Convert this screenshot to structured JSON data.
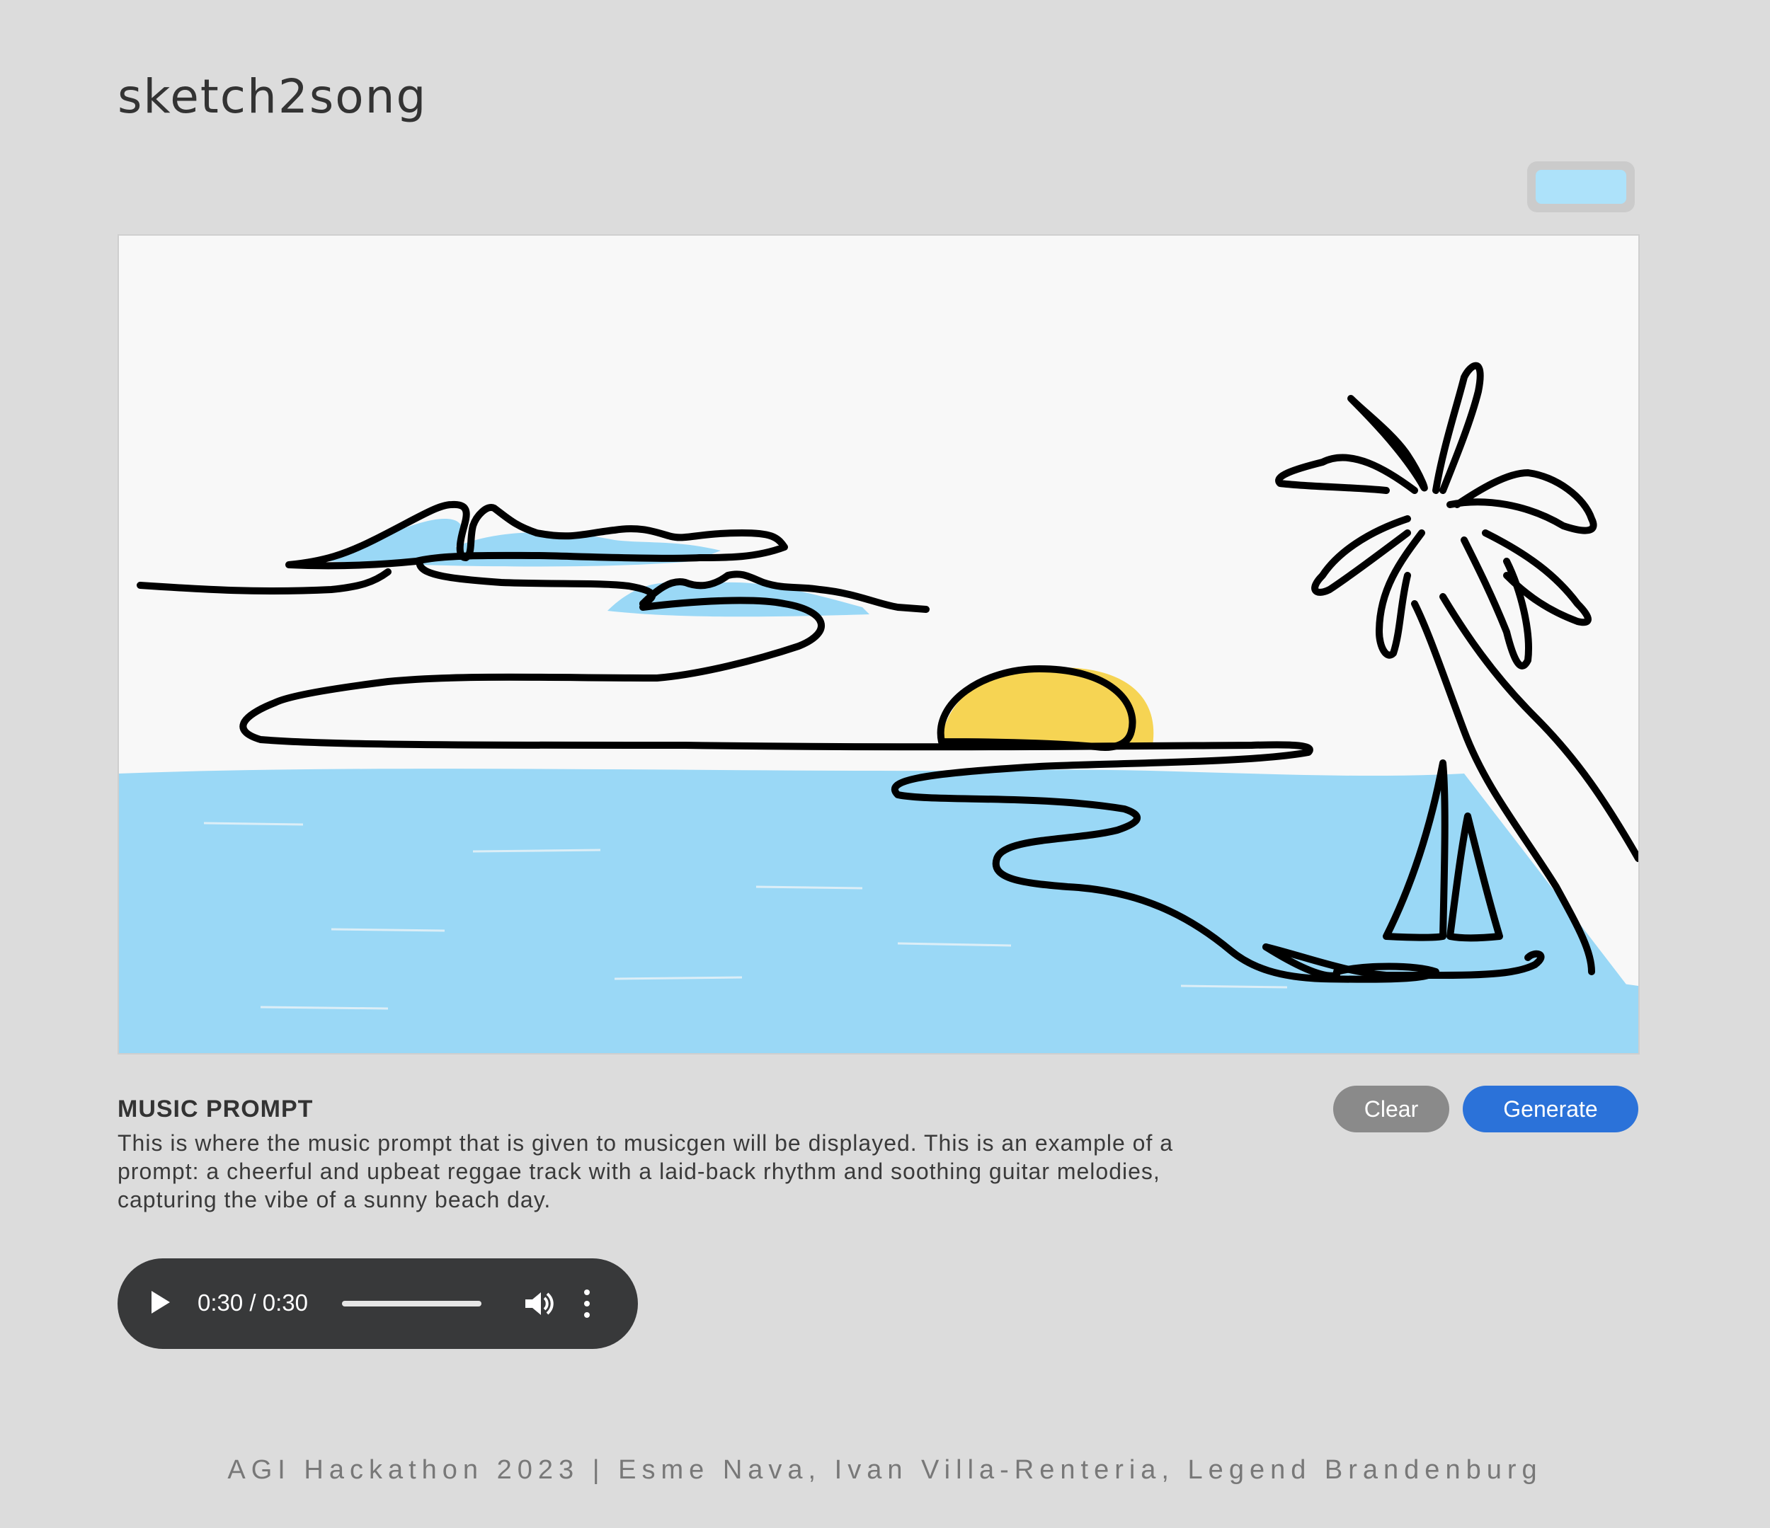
{
  "app": {
    "title": "sketch2song"
  },
  "color_picker": {
    "selected_color": "#ade2fa"
  },
  "canvas": {
    "background": "#f8f8f8",
    "colors": {
      "water": "#9ad8f6",
      "sun": "#f6d453",
      "ink": "#000000"
    }
  },
  "prompt": {
    "heading": "MUSIC PROMPT",
    "text": "This is where the music prompt that is given to musicgen will be displayed. This is an example of a prompt: a cheerful and upbeat reggae track with a laid-back rhythm and soothing guitar melodies, capturing the vibe of a sunny beach day."
  },
  "buttons": {
    "clear": "Clear",
    "generate": "Generate",
    "clear_color": "#8a8a8a",
    "generate_color": "#2b72d9"
  },
  "audio": {
    "time": "0:30 / 0:30",
    "progress": 1.0
  },
  "footer": {
    "text": "AGI Hackathon 2023 | Esme Nava, Ivan Villa-Renteria, Legend Brandenburg"
  }
}
